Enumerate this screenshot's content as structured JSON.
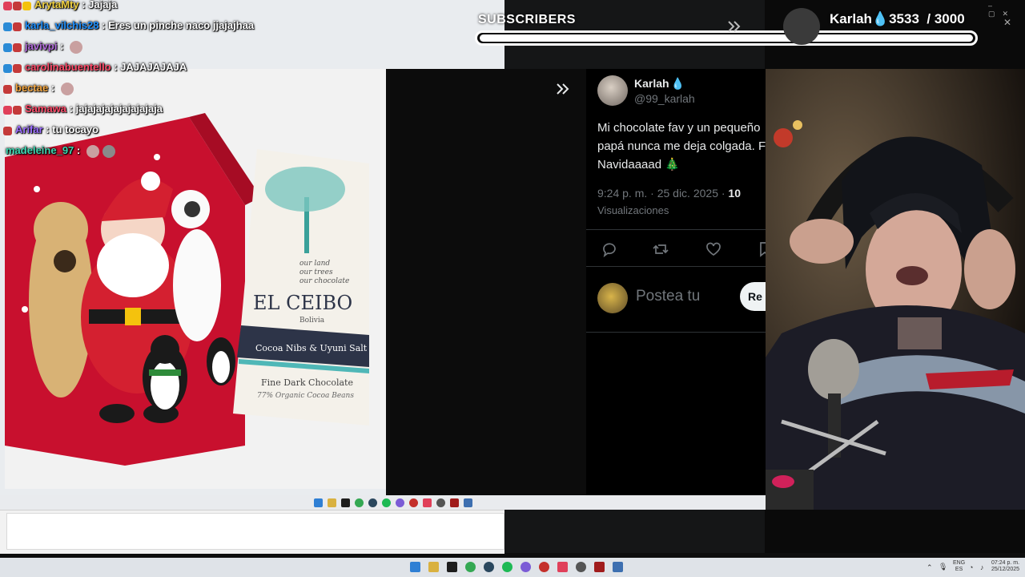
{
  "chat": [
    {
      "user": "ArytaMty",
      "message": "Jajaja",
      "user_color": "#f0d040",
      "badges": [
        "#e0405a",
        "#c43a3a",
        "#f4c20d"
      ],
      "emotes": 0
    },
    {
      "user": "karla_vilchis28",
      "message": "Eres un pinche naco jjajajhaa",
      "user_color": "#1e90ff",
      "badges": [
        "#2a8bd6",
        "#c43a3a"
      ],
      "emotes": 0
    },
    {
      "user": "javivpi",
      "message": "",
      "user_color": "#b06ad9",
      "badges": [
        "#2a8bd6",
        "#c43a3a"
      ],
      "emotes": 1
    },
    {
      "user": "carolinabuentello",
      "message": "JAJAJAJAJA",
      "user_color": "#ff4b6a",
      "badges": [
        "#2a8bd6",
        "#c43a3a"
      ],
      "emotes": 0
    },
    {
      "user": "bectae",
      "message": "",
      "user_color": "#f4a742",
      "badges": [
        "#c43a3a"
      ],
      "emotes": 1
    },
    {
      "user": "Samawa",
      "message": "jajajajajajajajajaja",
      "user_color": "#ff4b6a",
      "badges": [
        "#e0405a",
        "#c43a3a"
      ],
      "emotes": 0
    },
    {
      "user": "Arifar",
      "message": "tu tocayo",
      "user_color": "#9b6dff",
      "badges": [
        "#c43a3a"
      ],
      "emotes": 0
    },
    {
      "user": "madeleine_97",
      "message": "",
      "user_color": "#3cd6b0",
      "badges": [],
      "emotes": 2
    }
  ],
  "subs": {
    "label": "SUBSCRIBERS",
    "count": "3533",
    "goal": "3000",
    "streamer": "Karlah",
    "progress": 1.0
  },
  "tweet": {
    "name": "Karlah",
    "verified_emoji": "💧",
    "handle": "@99_karlah",
    "text_lines": [
      "Mi chocolate fav y un pequeño",
      "papá nunca me deja colgada. Feliz",
      "Navidaaaad 🎄"
    ],
    "time": "9:24 p. m. · 25 dic. 2025 ·",
    "views_count": "10",
    "views_label": "Visualizaciones",
    "reply_placeholder": "Postea tu",
    "reply_button": "Re"
  },
  "product": {
    "brand": "EL CEIBO",
    "tagline": [
      "our land",
      "our trees",
      "our chocolate"
    ],
    "origin": "Bolivia",
    "flavor": "Cocoa Nibs & Uyuni Salt",
    "type": "Fine Dark Chocolate",
    "cocoa": "77% Organic Cocoa Beans"
  },
  "tray": {
    "lang_top": "ENG",
    "lang_bottom": "ES",
    "time": "07:24 p. m.",
    "date": "25/12/2025"
  },
  "colors": {
    "accent": "#ffffff",
    "twitter_bg": "#000000",
    "muted": "#71767b"
  }
}
